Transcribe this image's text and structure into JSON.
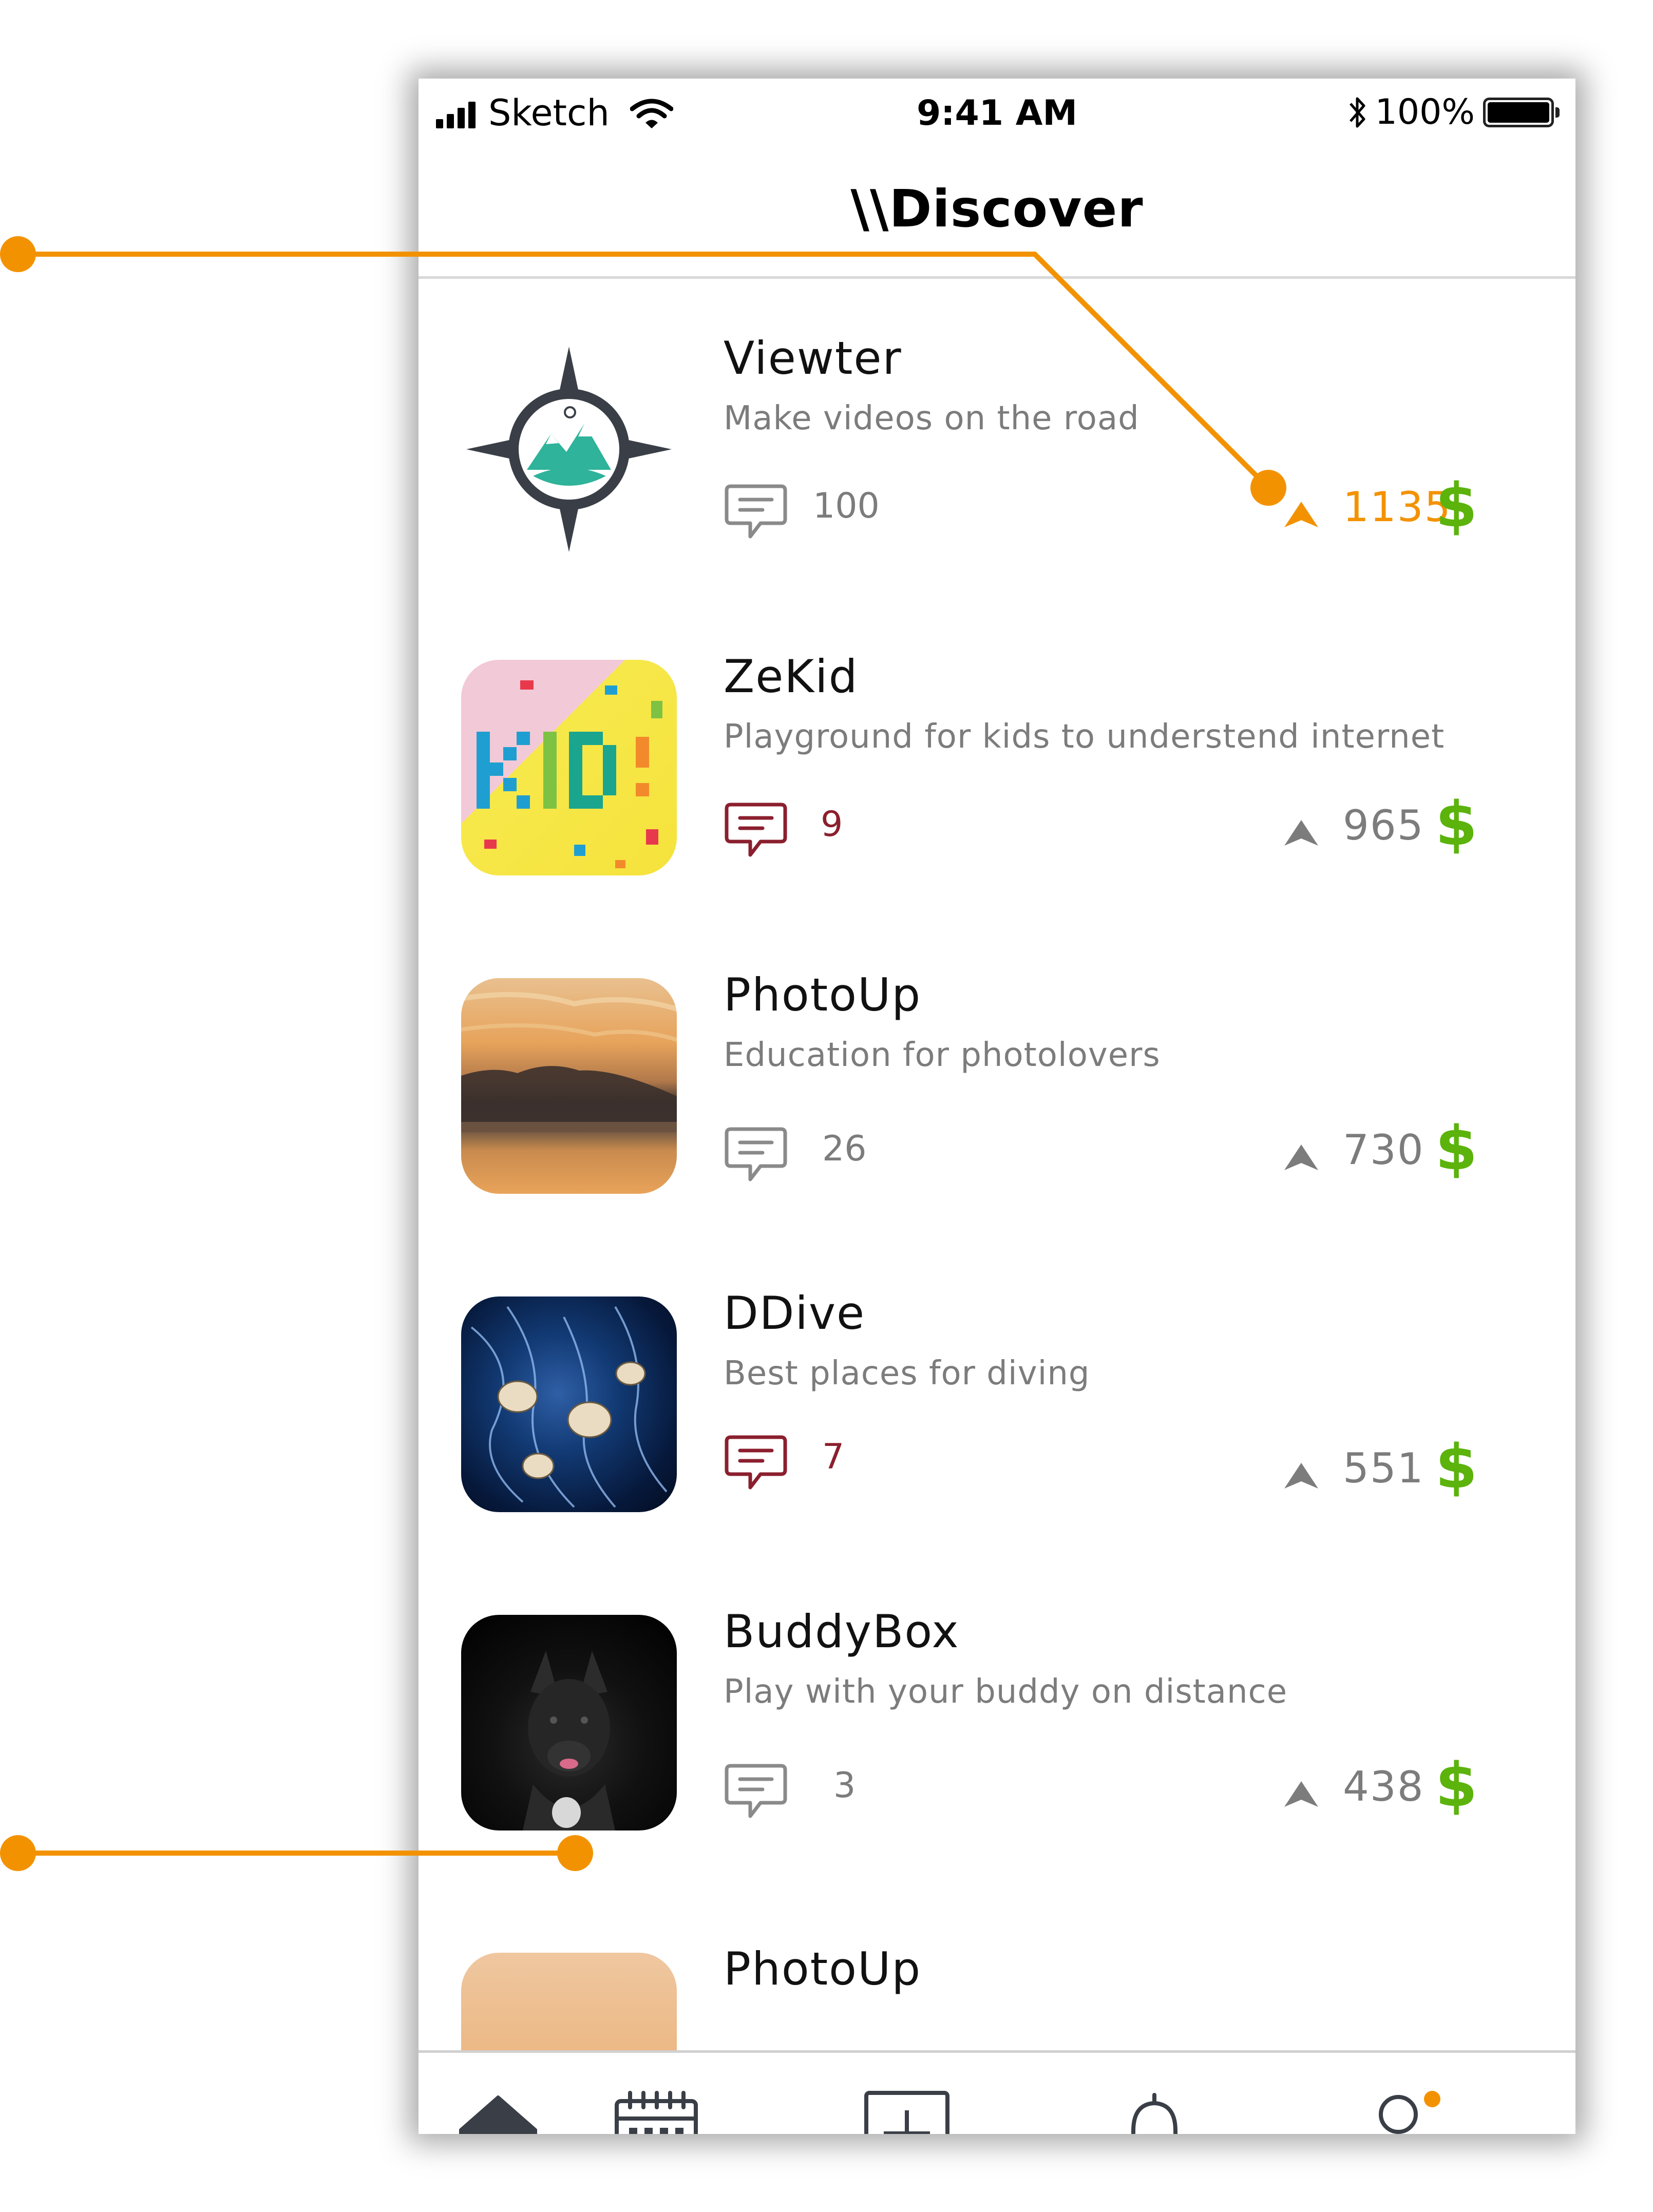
{
  "status_bar": {
    "carrier": "Sketch",
    "time": "9:41 AM",
    "battery": "100%"
  },
  "header": {
    "title": "\\\\Discover"
  },
  "apps": [
    {
      "name": "Viewter",
      "description": "Make videos on the road",
      "comments": "100",
      "upvotes": "1135",
      "upvoted": true,
      "comments_unread": false,
      "price_symbol": "$",
      "thumb": "compass-logo"
    },
    {
      "name": "ZeKid",
      "description": "Playground for kids to understend internet",
      "comments": "9",
      "upvotes": "965",
      "upvoted": false,
      "comments_unread": true,
      "price_symbol": "$",
      "thumb": "kids-letters"
    },
    {
      "name": "PhotoUp",
      "description": "Education for photolovers",
      "comments": "26",
      "upvotes": "730",
      "upvoted": false,
      "comments_unread": false,
      "price_symbol": "$",
      "thumb": "sunset"
    },
    {
      "name": "DDive",
      "description": "Best places for diving",
      "comments": "7",
      "upvotes": "551",
      "upvoted": false,
      "comments_unread": true,
      "price_symbol": "$",
      "thumb": "jellyfish"
    },
    {
      "name": "BuddyBox",
      "description": "Play with your buddy on distance",
      "comments": "3",
      "upvotes": "438",
      "upvoted": false,
      "comments_unread": false,
      "price_symbol": "$",
      "thumb": "dog"
    },
    {
      "name": "PhotoUp",
      "description": "",
      "comments": "",
      "upvotes": "",
      "upvoted": false,
      "comments_unread": false,
      "price_symbol": "",
      "thumb": "sunset"
    }
  ],
  "tab_bar": {
    "items": [
      {
        "icon": "home-icon",
        "active": true
      },
      {
        "icon": "calendar-icon",
        "active": false
      },
      {
        "icon": "add-icon",
        "active": false
      },
      {
        "icon": "bell-icon",
        "active": false
      },
      {
        "icon": "profile-icon",
        "active": false,
        "badge": true
      }
    ]
  },
  "colors": {
    "accent": "#f39200",
    "price": "#5bb30c",
    "unread_comment": "#8b1f2e",
    "muted_text": "#7c7c7c",
    "icon_dark": "#3a3f47"
  }
}
